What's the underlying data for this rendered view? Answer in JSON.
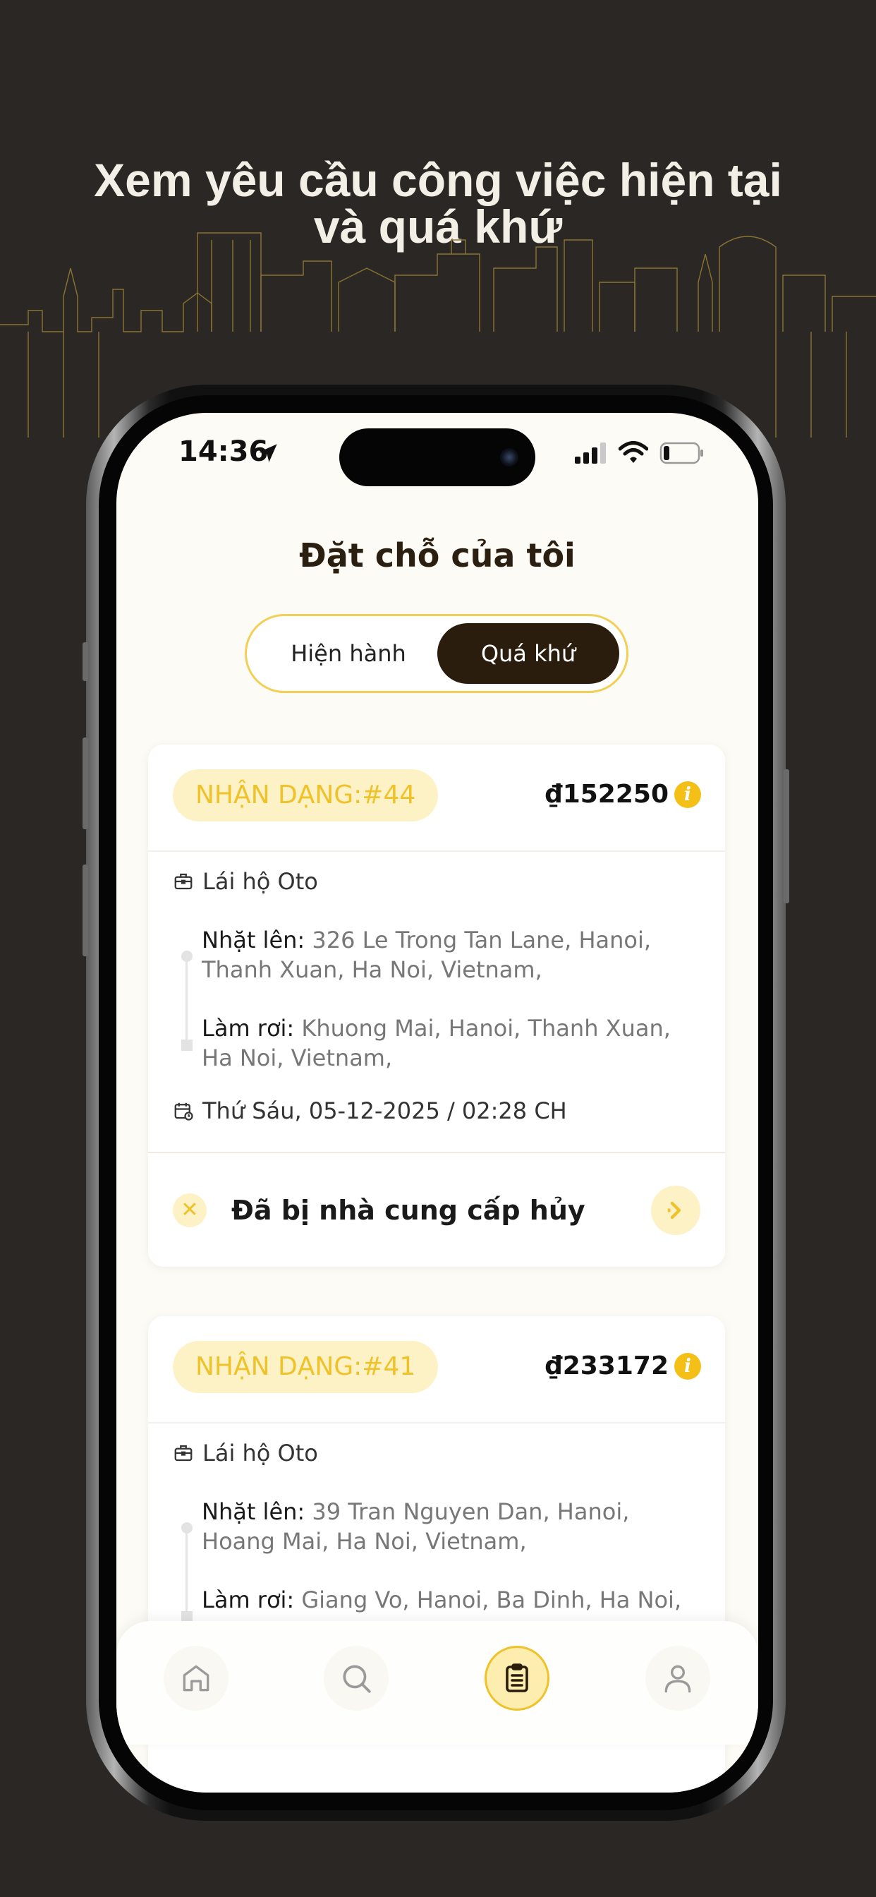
{
  "headline": {
    "line1": "Xem yêu cầu công việc hiện tại",
    "line2": "và quá khứ"
  },
  "status_bar": {
    "time": "14:36"
  },
  "page": {
    "title": "Đặt chỗ của tôi"
  },
  "tabs": {
    "current": "Hiện hành",
    "past": "Quá khứ",
    "selected": "past"
  },
  "bookings": [
    {
      "id_label": "NHẬN DẠNG:#44",
      "price": "₫152250",
      "service": "Lái hộ Oto",
      "pickup_label": "Nhặt lên:",
      "pickup": "326 Le Trong Tan Lane, Hanoi, Thanh Xuan, Ha Noi, Vietnam,",
      "dropoff_label": "Làm rơi:",
      "dropoff": "Khuong Mai, Hanoi, Thanh Xuan, Ha Noi, Vietnam,",
      "datetime": "Thứ Sáu, 05-12-2025 / 02:28 CH",
      "status": "Đã bị nhà cung cấp hủy"
    },
    {
      "id_label": "NHẬN DẠNG:#41",
      "price": "₫233172",
      "service": "Lái hộ Oto",
      "pickup_label": "Nhặt lên:",
      "pickup": "39 Tran Nguyen Dan, Hanoi, Hoang Mai, Ha Noi, Vietnam,",
      "dropoff_label": "Làm rơi:",
      "dropoff": "Giang Vo, Hanoi, Ba Dinh, Ha Noi,"
    }
  ],
  "nav": {
    "items": [
      "home-icon",
      "search-icon",
      "clipboard-icon",
      "user-icon"
    ],
    "active": "clipboard-icon"
  },
  "colors": {
    "background": "#2b2725",
    "accent": "#efc22a",
    "accent_light": "#fdf2c6",
    "dark_brown": "#2a1d0d"
  }
}
